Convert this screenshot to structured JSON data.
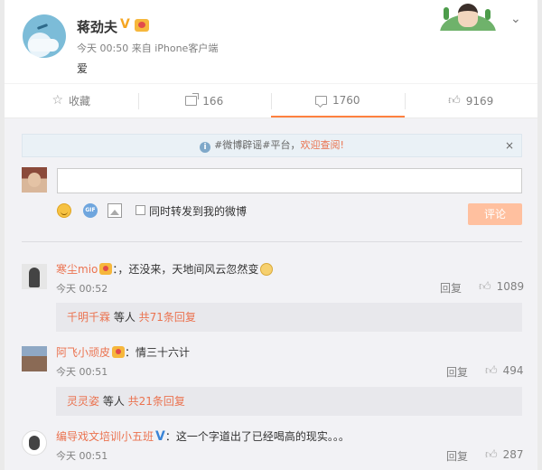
{
  "post": {
    "author": "蒋劲夫",
    "verified_badge": "V",
    "meta": "今天 00:50 来自 iPhone客户端",
    "text": "爱"
  },
  "actions": {
    "favorite_label": "收藏",
    "forward_count": "166",
    "comment_count": "1760",
    "like_count": "9169"
  },
  "notice": {
    "prefix": "#微博辟谣#平台，",
    "link": "欢迎查阅!",
    "close": "×"
  },
  "compose": {
    "input_value": "",
    "gif_label": "GIF",
    "checkbox_label": "同时转发到我的微博",
    "submit_label": "评论"
  },
  "comments": [
    {
      "user": "寒尘mio",
      "text": "：，还没来，天地间风云忽然变",
      "time": "今天 00:52",
      "reply_label": "回复",
      "likes": "1089",
      "sub_reply": {
        "user": "千明千霖",
        "mid": " 等人 ",
        "count_text": "共71条回复"
      }
    },
    {
      "user": "阿飞小顽皮",
      "text": "：情三十六计",
      "time": "今天 00:51",
      "reply_label": "回复",
      "likes": "494",
      "sub_reply": {
        "user": "灵灵姿",
        "mid": " 等人 ",
        "count_text": "共21条回复"
      }
    },
    {
      "user": "编导戏文培训小五班",
      "badge": "V",
      "text": "：这一个字道出了已经喝高的现实。。。",
      "time": "今天 00:51",
      "reply_label": "回复",
      "likes": "287"
    }
  ],
  "colors": {
    "accent": "#eb7350",
    "submit_disabled": "#ffc09f",
    "verified_blue": "#3a84d6"
  }
}
